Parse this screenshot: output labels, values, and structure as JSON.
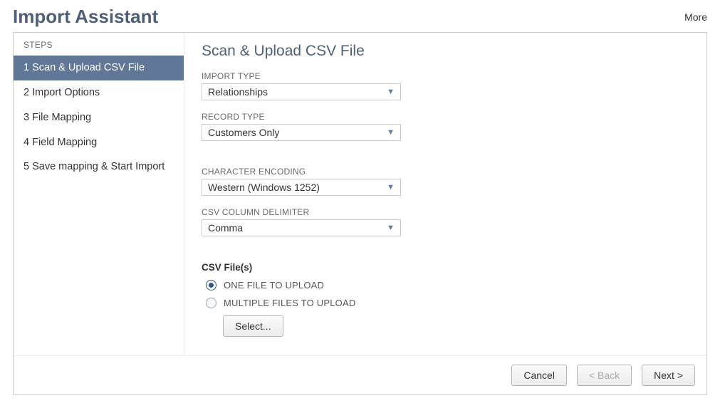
{
  "header": {
    "title": "Import Assistant",
    "more_label": "More"
  },
  "sidebar": {
    "title": "STEPS",
    "steps": [
      {
        "label": "1 Scan & Upload CSV File",
        "active": true
      },
      {
        "label": "2 Import Options",
        "active": false
      },
      {
        "label": "3 File Mapping",
        "active": false
      },
      {
        "label": "4 Field Mapping",
        "active": false
      },
      {
        "label": "5 Save mapping & Start Import",
        "active": false
      }
    ]
  },
  "main": {
    "title": "Scan & Upload CSV File",
    "import_type": {
      "label": "IMPORT TYPE",
      "value": "Relationships"
    },
    "record_type": {
      "label": "RECORD TYPE",
      "value": "Customers Only"
    },
    "encoding": {
      "label": "CHARACTER ENCODING",
      "value": "Western (Windows 1252)"
    },
    "delimiter": {
      "label": "CSV COLUMN DELIMITER",
      "value": "Comma"
    },
    "csv_files": {
      "label": "CSV File(s)",
      "option_one": "ONE FILE TO UPLOAD",
      "option_multi": "MULTIPLE FILES TO UPLOAD",
      "select_label": "Select..."
    }
  },
  "footer": {
    "cancel": "Cancel",
    "back": "< Back",
    "next": "Next >"
  }
}
